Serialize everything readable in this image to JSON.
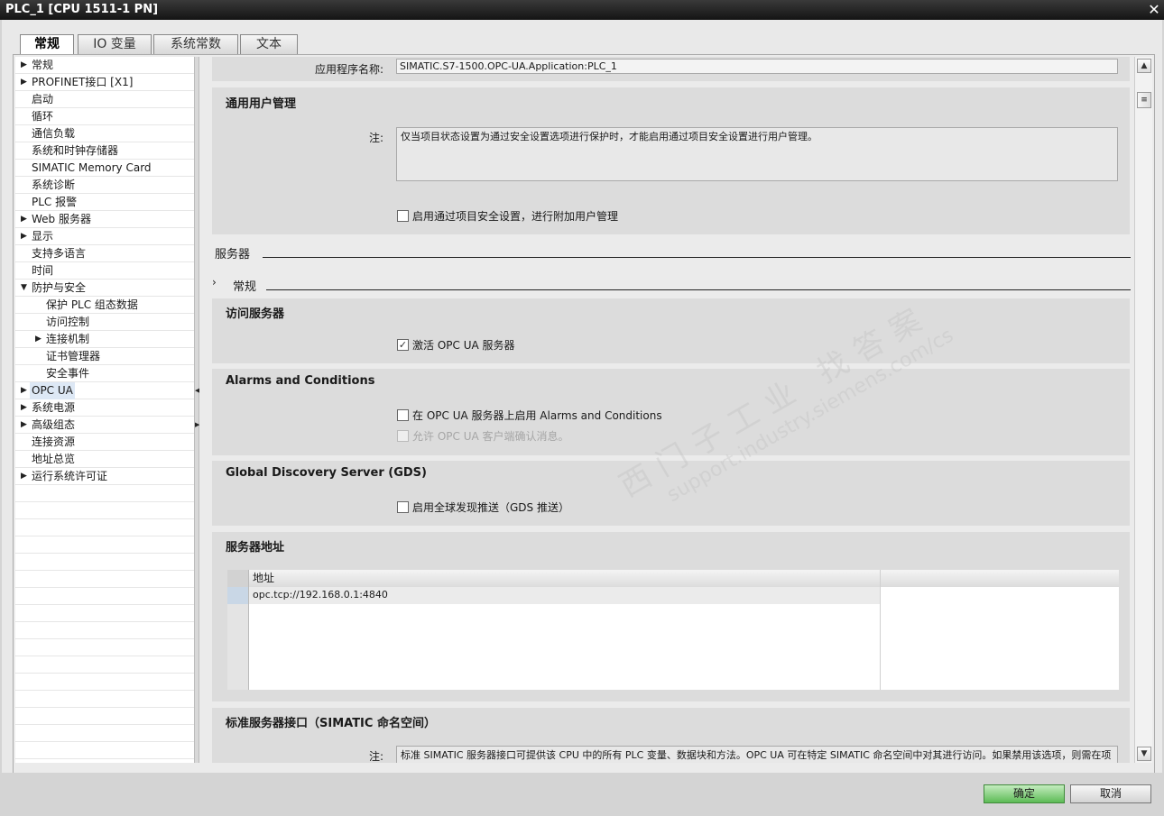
{
  "window": {
    "title": "PLC_1 [CPU 1511-1 PN]",
    "close": "✕"
  },
  "tabs": [
    {
      "label": "常规"
    },
    {
      "label": "IO 变量"
    },
    {
      "label": "系统常数"
    },
    {
      "label": "文本"
    }
  ],
  "tree": [
    {
      "label": "常规",
      "arrow": "▶"
    },
    {
      "label": "PROFINET接口 [X1]",
      "arrow": "▶"
    },
    {
      "label": "启动",
      "arrow": ""
    },
    {
      "label": "循环",
      "arrow": ""
    },
    {
      "label": "通信负载",
      "arrow": ""
    },
    {
      "label": "系统和时钟存储器",
      "arrow": ""
    },
    {
      "label": "SIMATIC Memory Card",
      "arrow": ""
    },
    {
      "label": "系统诊断",
      "arrow": ""
    },
    {
      "label": "PLC 报警",
      "arrow": ""
    },
    {
      "label": "Web 服务器",
      "arrow": "▶"
    },
    {
      "label": "显示",
      "arrow": "▶"
    },
    {
      "label": "支持多语言",
      "arrow": ""
    },
    {
      "label": "时间",
      "arrow": ""
    },
    {
      "label": "防护与安全",
      "arrow": "▼"
    },
    {
      "label": "保护 PLC 组态数据",
      "arrow": ""
    },
    {
      "label": "访问控制",
      "arrow": ""
    },
    {
      "label": "连接机制",
      "arrow": "▶"
    },
    {
      "label": "证书管理器",
      "arrow": ""
    },
    {
      "label": "安全事件",
      "arrow": ""
    },
    {
      "label": "OPC UA",
      "arrow": "▶"
    },
    {
      "label": "系统电源",
      "arrow": "▶"
    },
    {
      "label": "高级组态",
      "arrow": "▶"
    },
    {
      "label": "连接资源",
      "arrow": ""
    },
    {
      "label": "地址总览",
      "arrow": ""
    },
    {
      "label": "运行系统许可证",
      "arrow": "▶"
    }
  ],
  "app_name": {
    "label": "应用程序名称:",
    "value": "SIMATIC.S7-1500.OPC-UA.Application:PLC_1"
  },
  "user_mgmt": {
    "title": "通用用户管理",
    "note_label": "注:",
    "note": "仅当项目状态设置为通过安全设置选项进行保护时，才能启用通过项目安全设置进行用户管理。",
    "checkbox": "启用通过项目安全设置，进行附加用户管理"
  },
  "server_heading": "服务器",
  "general_heading": "常规",
  "general_chevron": "›",
  "access_server": {
    "title": "访问服务器",
    "checkbox": "激活 OPC UA 服务器",
    "checked_mark": "✓"
  },
  "alarms": {
    "title": "Alarms and Conditions",
    "checkbox1": "在 OPC UA 服务器上启用 Alarms and Conditions",
    "checkbox2": "允许 OPC UA 客户端确认消息。"
  },
  "gds": {
    "title": "Global Discovery Server (GDS)",
    "checkbox": "启用全球发现推送（GDS 推送）"
  },
  "server_address": {
    "title": "服务器地址",
    "column": "地址",
    "rows": [
      "opc.tcp://192.168.0.1:4840",
      "",
      "",
      "",
      "",
      ""
    ]
  },
  "std_interface": {
    "title": "标准服务器接口（SIMATIC 命名空间）",
    "note_label": "注:",
    "note": "标准 SIMATIC 服务器接口可提供该 CPU 中的所有 PLC 变量、数据块和方法。OPC UA 可在特定 SIMATIC 命名空间中对其进行访问。如果禁用该选项，则需在项目树中，OPC UA 通信下创建并访问用户服务器接口。"
  },
  "scroll": {
    "up": "▲",
    "down": "▼",
    "thumb": "≡"
  },
  "splitter": {
    "knob": "◀",
    "knob2": "▶"
  },
  "watermark": {
    "line1": "西门子工业  找答案",
    "line2": "support.industry.siemens.com/cs"
  },
  "buttons": {
    "ok": "确定",
    "cancel": "取消"
  }
}
